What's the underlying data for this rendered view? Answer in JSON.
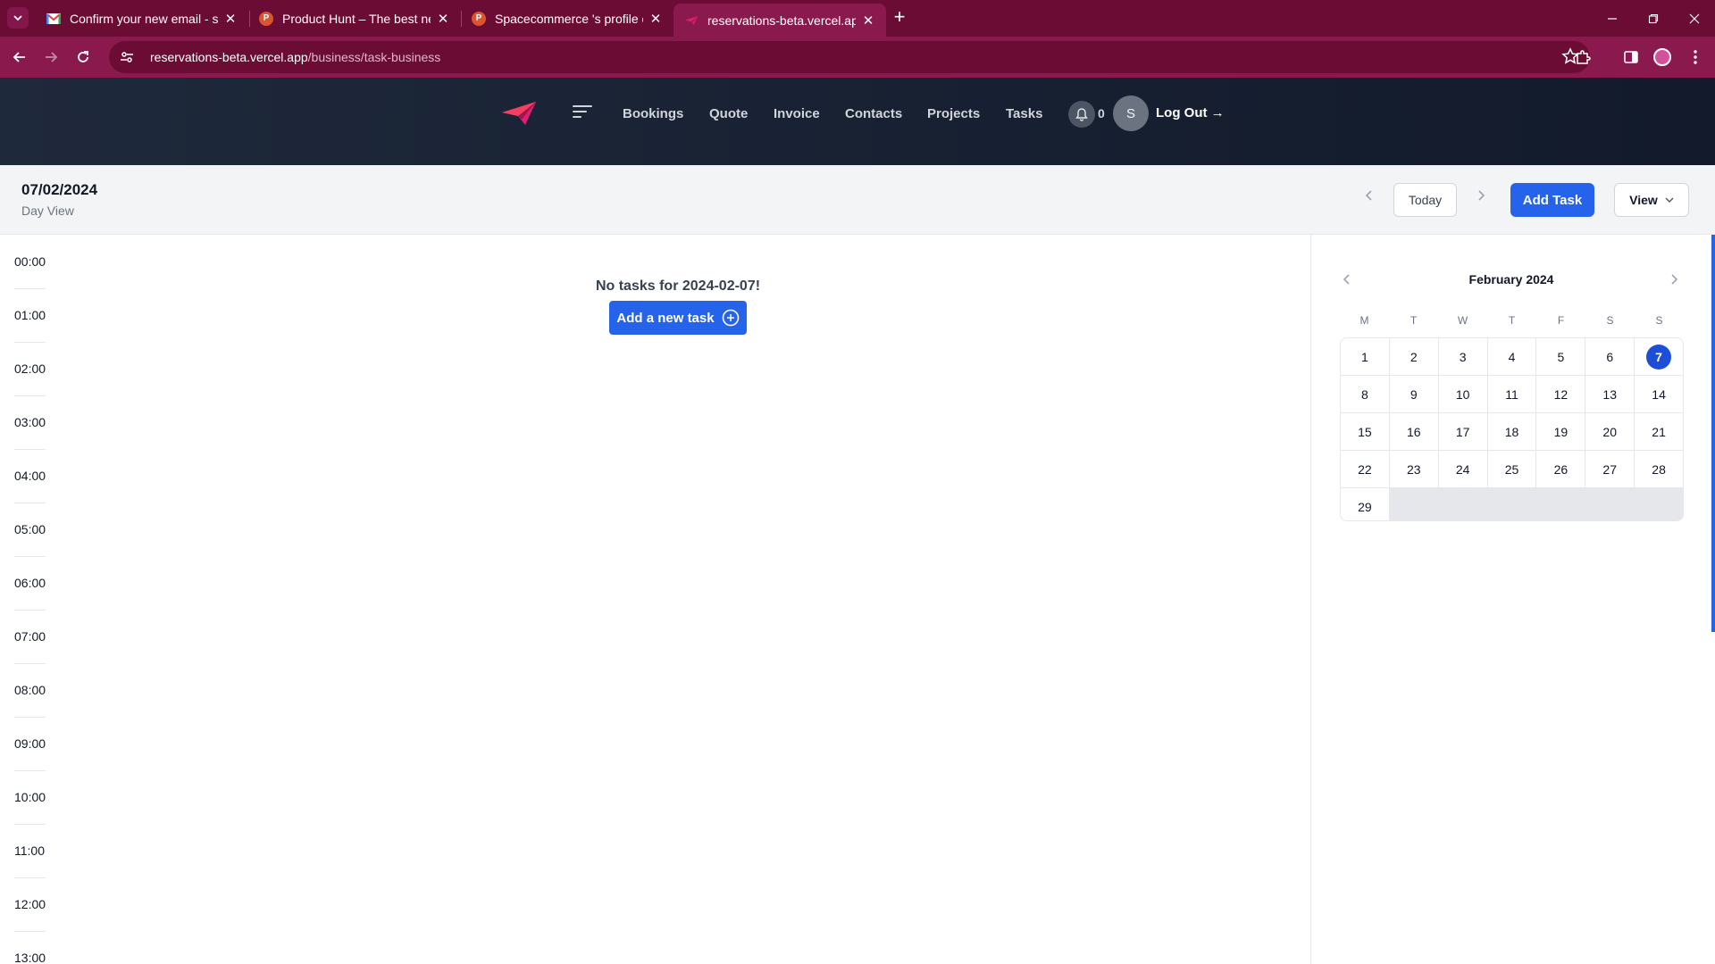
{
  "browser": {
    "tabs": [
      {
        "title": "Confirm your new email - supp",
        "favicon": "gmail-icon"
      },
      {
        "title": "Product Hunt – The best new p",
        "favicon": "producthunt-icon"
      },
      {
        "title": "Spacecommerce 's profile on Pr",
        "favicon": "producthunt-icon"
      },
      {
        "title": "reservations-beta.vercel.app/bu",
        "favicon": "paper-plane-icon"
      }
    ],
    "url_host": "reservations-beta.vercel.app",
    "url_path": "/business/task-business"
  },
  "header": {
    "nav": [
      "Bookings",
      "Quote",
      "Invoice",
      "Contacts",
      "Projects",
      "Tasks"
    ],
    "notification_count": "0",
    "avatar_initial": "S",
    "logout_label": "Log Out →"
  },
  "subheader": {
    "date": "07/02/2024",
    "view_label": "Day View",
    "today_label": "Today",
    "add_task_label": "Add Task",
    "view_button_label": "View"
  },
  "day": {
    "times": [
      "00:00",
      "01:00",
      "02:00",
      "03:00",
      "04:00",
      "05:00",
      "06:00",
      "07:00",
      "08:00",
      "09:00",
      "10:00",
      "11:00",
      "12:00",
      "13:00"
    ],
    "empty_message": "No tasks for 2024-02-07!",
    "add_new_task_label": "Add a new task"
  },
  "calendar": {
    "month_title": "February 2024",
    "weekdays": [
      "M",
      "T",
      "W",
      "T",
      "F",
      "S",
      "S"
    ],
    "days": [
      "1",
      "2",
      "3",
      "4",
      "5",
      "6",
      "7",
      "8",
      "9",
      "10",
      "11",
      "12",
      "13",
      "14",
      "15",
      "16",
      "17",
      "18",
      "19",
      "20",
      "21",
      "22",
      "23",
      "24",
      "25",
      "26",
      "27",
      "28",
      "29"
    ],
    "selected_day": "7"
  },
  "colors": {
    "browser_frame": "#6b0c34",
    "primary": "#2563eb",
    "header_bg": "#1e293b"
  }
}
